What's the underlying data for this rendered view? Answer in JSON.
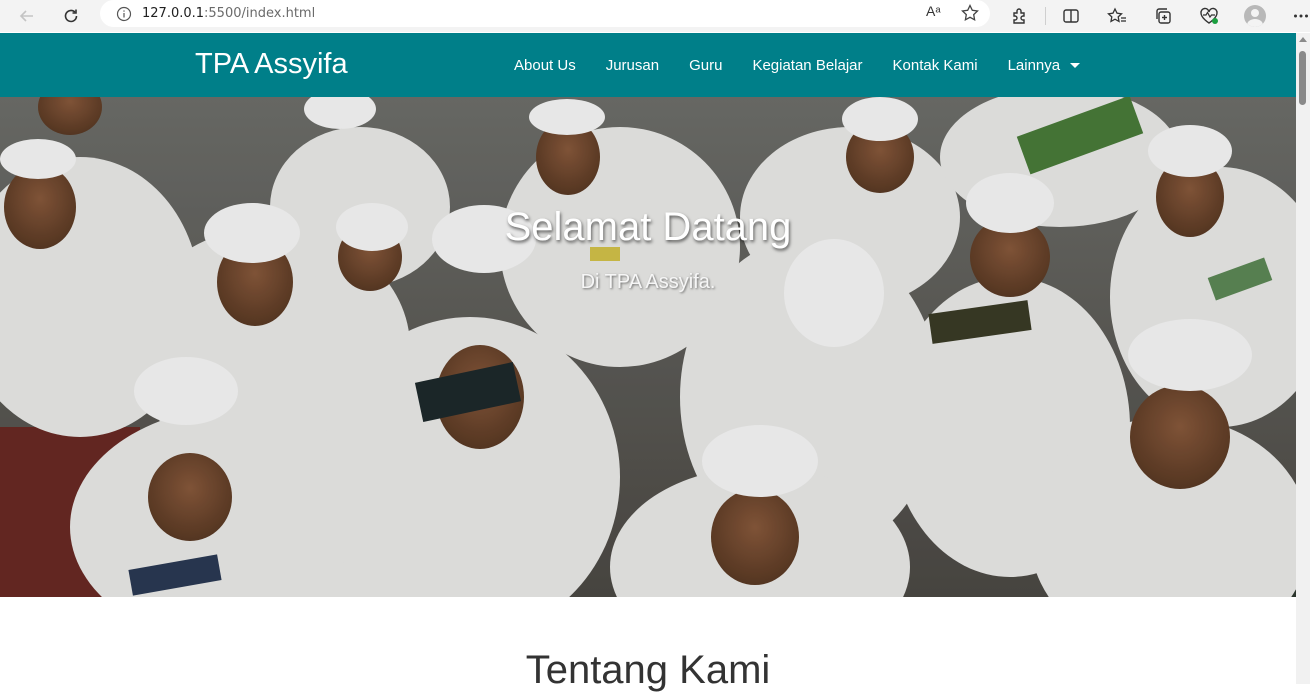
{
  "browser": {
    "url_host": "127.0.0.1",
    "url_rest": ":5500/index.html",
    "read_aloud_label": "Aᵃ"
  },
  "site": {
    "brand": "TPA Assyifa",
    "nav": [
      "About Us",
      "Jurusan",
      "Guru",
      "Kegiatan Belajar",
      "Kontak Kami",
      "Lainnya"
    ]
  },
  "hero": {
    "title": "Selamat Datang",
    "subtitle": "Di TPA Assyifa."
  },
  "section": {
    "title": "Tentang Kami"
  },
  "colors": {
    "navbar": "#007f89",
    "browser_chrome": "#f3f3f3"
  }
}
